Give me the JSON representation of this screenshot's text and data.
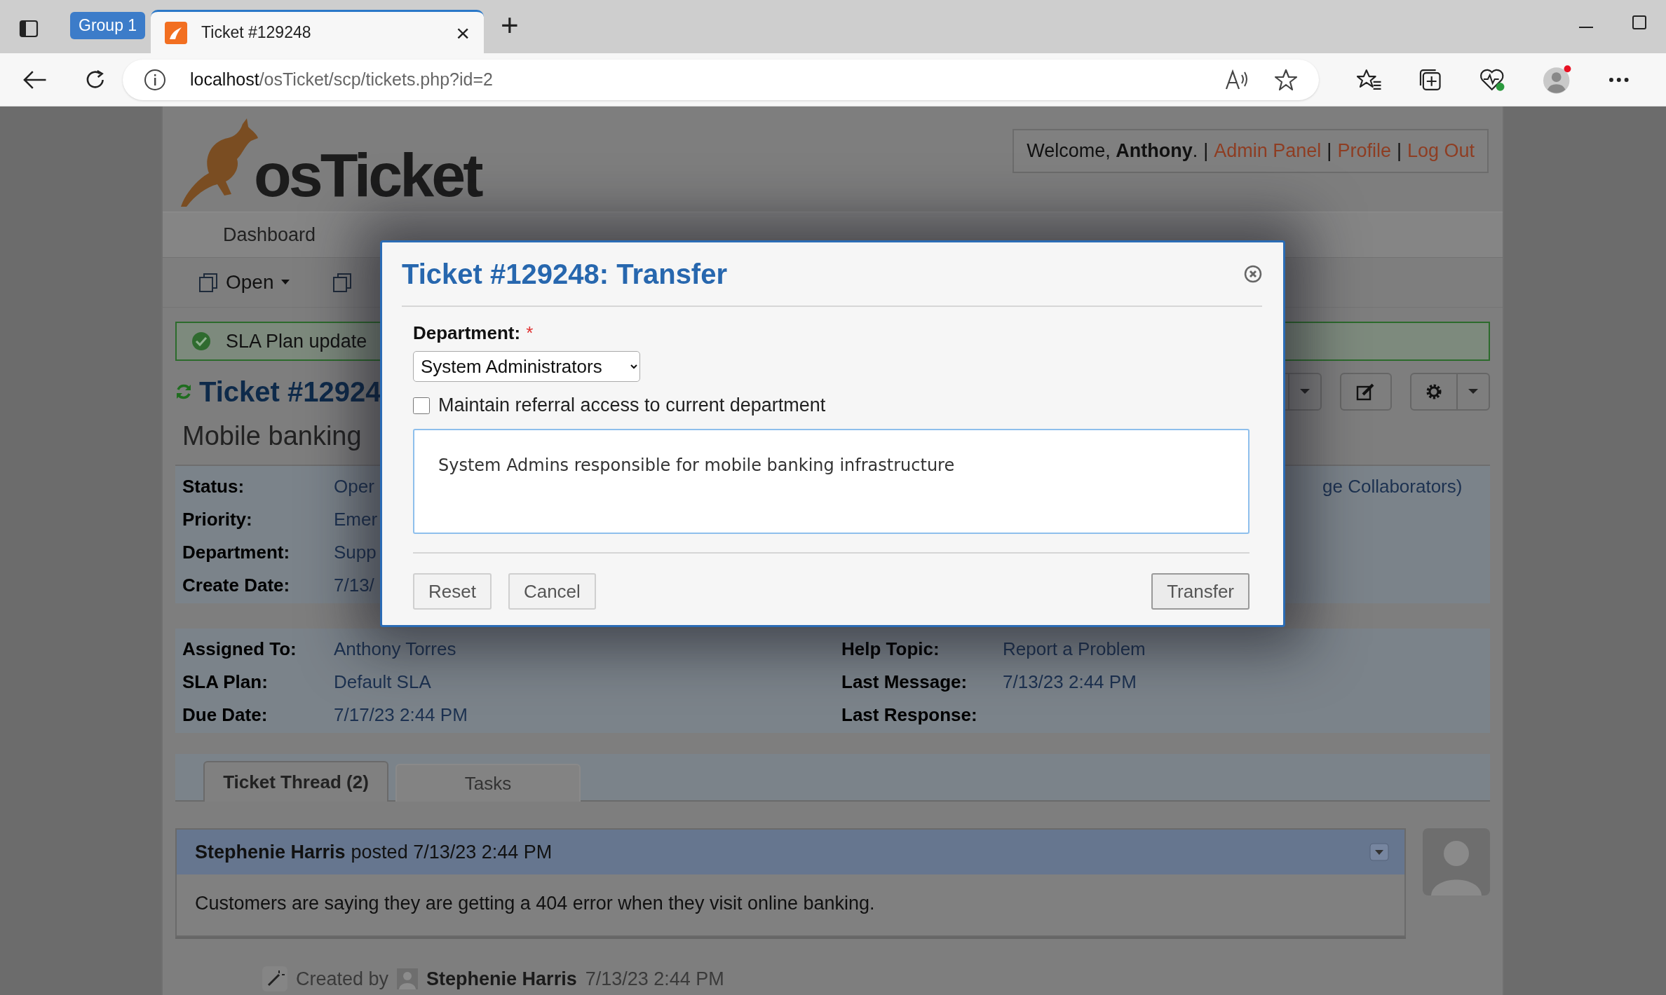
{
  "browser": {
    "tabs": [
      {
        "label": "Group 1",
        "kind": "group",
        "selected": false
      },
      {
        "label": "Ticket #129248",
        "kind": "page",
        "selected": true
      }
    ],
    "close_tab": "×",
    "new_tab": "+",
    "address": {
      "host": "localhost",
      "path": "/osTicket/scp/tickets.php?id=2"
    }
  },
  "header": {
    "logo": "osTicket",
    "welcome": "Welcome, **Anthony**.",
    "separator": "|",
    "links": [
      "Admin Panel",
      "Profile",
      "Log Out"
    ]
  },
  "nav": [
    {
      "label": "Dashboard",
      "selected": false
    }
  ],
  "toolbar": [
    {
      "label": "Open",
      "kind": "dropdown"
    },
    {
      "kind": "icon"
    }
  ],
  "banner": "SLA Plan update",
  "ticket": {
    "number": "Ticket #12924",
    "subject": "Mobile banking"
  },
  "details": [
    {
      "label": "Status:",
      "value": "Oper"
    },
    {
      "label": "Priority:",
      "value": "Emer"
    },
    {
      "label": "Department:",
      "value": "Supp"
    },
    {
      "label": "Create Date:",
      "value": "7/13/"
    }
  ],
  "details_right": "ge Collaborators)",
  "details2": [
    {
      "label": "Assigned To:",
      "value": "Anthony Torres"
    },
    {
      "label": "Help Topic:",
      "value": "Report a Problem"
    },
    {
      "label": "SLA Plan:",
      "value": "Default SLA"
    },
    {
      "label": "Last Message:",
      "value": "7/13/23 2:44 PM"
    },
    {
      "label": "Due Date:",
      "value": "7/17/23 2:44 PM"
    },
    {
      "label": "Last Response:"
    }
  ],
  "thread_tabs": [
    {
      "label": "Ticket Thread (2)",
      "selected": true
    },
    {
      "label": "Tasks",
      "selected": false
    }
  ],
  "entry": {
    "author": "Stephenie Harris",
    "posted": "posted 7/13/23 2:44 PM",
    "body": "Customers are saying they are getting a 404 error when they visit online banking."
  },
  "event": {
    "prefix": "Created by",
    "author": "Stephenie Harris",
    "time": "7/13/23 2:44 PM"
  },
  "modal": {
    "title": "Ticket #129248: Transfer",
    "department_label": "Department:",
    "required": "*",
    "department": "System Administrators",
    "referral": {
      "label": "Maintain referral access to current department",
      "checked": false
    },
    "comment": "System Admins responsible for mobile banking infrastructure",
    "buttons": [
      {
        "label": "Reset",
        "kind": "reset"
      },
      {
        "label": "Cancel",
        "kind": "cancel"
      },
      {
        "label": "Transfer",
        "kind": "submit"
      }
    ]
  }
}
